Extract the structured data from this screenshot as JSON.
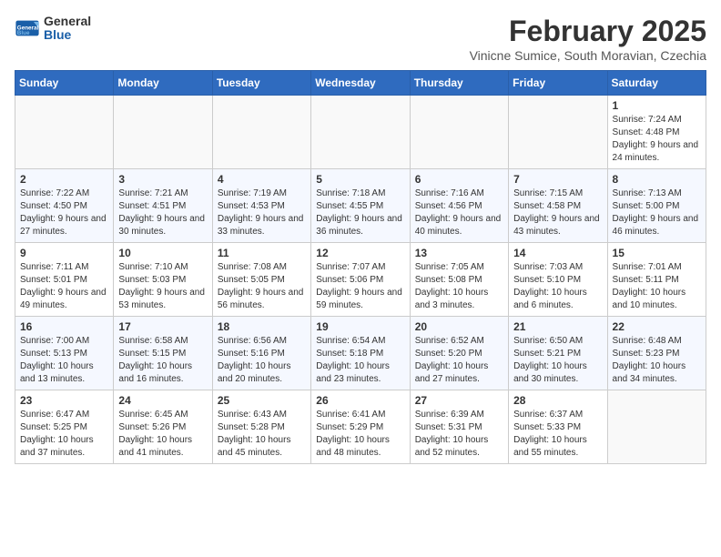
{
  "header": {
    "logo_general": "General",
    "logo_blue": "Blue",
    "month_title": "February 2025",
    "subtitle": "Vinicne Sumice, South Moravian, Czechia"
  },
  "weekdays": [
    "Sunday",
    "Monday",
    "Tuesday",
    "Wednesday",
    "Thursday",
    "Friday",
    "Saturday"
  ],
  "weeks": [
    [
      {
        "day": "",
        "info": ""
      },
      {
        "day": "",
        "info": ""
      },
      {
        "day": "",
        "info": ""
      },
      {
        "day": "",
        "info": ""
      },
      {
        "day": "",
        "info": ""
      },
      {
        "day": "",
        "info": ""
      },
      {
        "day": "1",
        "info": "Sunrise: 7:24 AM\nSunset: 4:48 PM\nDaylight: 9 hours and 24 minutes."
      }
    ],
    [
      {
        "day": "2",
        "info": "Sunrise: 7:22 AM\nSunset: 4:50 PM\nDaylight: 9 hours and 27 minutes."
      },
      {
        "day": "3",
        "info": "Sunrise: 7:21 AM\nSunset: 4:51 PM\nDaylight: 9 hours and 30 minutes."
      },
      {
        "day": "4",
        "info": "Sunrise: 7:19 AM\nSunset: 4:53 PM\nDaylight: 9 hours and 33 minutes."
      },
      {
        "day": "5",
        "info": "Sunrise: 7:18 AM\nSunset: 4:55 PM\nDaylight: 9 hours and 36 minutes."
      },
      {
        "day": "6",
        "info": "Sunrise: 7:16 AM\nSunset: 4:56 PM\nDaylight: 9 hours and 40 minutes."
      },
      {
        "day": "7",
        "info": "Sunrise: 7:15 AM\nSunset: 4:58 PM\nDaylight: 9 hours and 43 minutes."
      },
      {
        "day": "8",
        "info": "Sunrise: 7:13 AM\nSunset: 5:00 PM\nDaylight: 9 hours and 46 minutes."
      }
    ],
    [
      {
        "day": "9",
        "info": "Sunrise: 7:11 AM\nSunset: 5:01 PM\nDaylight: 9 hours and 49 minutes."
      },
      {
        "day": "10",
        "info": "Sunrise: 7:10 AM\nSunset: 5:03 PM\nDaylight: 9 hours and 53 minutes."
      },
      {
        "day": "11",
        "info": "Sunrise: 7:08 AM\nSunset: 5:05 PM\nDaylight: 9 hours and 56 minutes."
      },
      {
        "day": "12",
        "info": "Sunrise: 7:07 AM\nSunset: 5:06 PM\nDaylight: 9 hours and 59 minutes."
      },
      {
        "day": "13",
        "info": "Sunrise: 7:05 AM\nSunset: 5:08 PM\nDaylight: 10 hours and 3 minutes."
      },
      {
        "day": "14",
        "info": "Sunrise: 7:03 AM\nSunset: 5:10 PM\nDaylight: 10 hours and 6 minutes."
      },
      {
        "day": "15",
        "info": "Sunrise: 7:01 AM\nSunset: 5:11 PM\nDaylight: 10 hours and 10 minutes."
      }
    ],
    [
      {
        "day": "16",
        "info": "Sunrise: 7:00 AM\nSunset: 5:13 PM\nDaylight: 10 hours and 13 minutes."
      },
      {
        "day": "17",
        "info": "Sunrise: 6:58 AM\nSunset: 5:15 PM\nDaylight: 10 hours and 16 minutes."
      },
      {
        "day": "18",
        "info": "Sunrise: 6:56 AM\nSunset: 5:16 PM\nDaylight: 10 hours and 20 minutes."
      },
      {
        "day": "19",
        "info": "Sunrise: 6:54 AM\nSunset: 5:18 PM\nDaylight: 10 hours and 23 minutes."
      },
      {
        "day": "20",
        "info": "Sunrise: 6:52 AM\nSunset: 5:20 PM\nDaylight: 10 hours and 27 minutes."
      },
      {
        "day": "21",
        "info": "Sunrise: 6:50 AM\nSunset: 5:21 PM\nDaylight: 10 hours and 30 minutes."
      },
      {
        "day": "22",
        "info": "Sunrise: 6:48 AM\nSunset: 5:23 PM\nDaylight: 10 hours and 34 minutes."
      }
    ],
    [
      {
        "day": "23",
        "info": "Sunrise: 6:47 AM\nSunset: 5:25 PM\nDaylight: 10 hours and 37 minutes."
      },
      {
        "day": "24",
        "info": "Sunrise: 6:45 AM\nSunset: 5:26 PM\nDaylight: 10 hours and 41 minutes."
      },
      {
        "day": "25",
        "info": "Sunrise: 6:43 AM\nSunset: 5:28 PM\nDaylight: 10 hours and 45 minutes."
      },
      {
        "day": "26",
        "info": "Sunrise: 6:41 AM\nSunset: 5:29 PM\nDaylight: 10 hours and 48 minutes."
      },
      {
        "day": "27",
        "info": "Sunrise: 6:39 AM\nSunset: 5:31 PM\nDaylight: 10 hours and 52 minutes."
      },
      {
        "day": "28",
        "info": "Sunrise: 6:37 AM\nSunset: 5:33 PM\nDaylight: 10 hours and 55 minutes."
      },
      {
        "day": "",
        "info": ""
      }
    ]
  ]
}
